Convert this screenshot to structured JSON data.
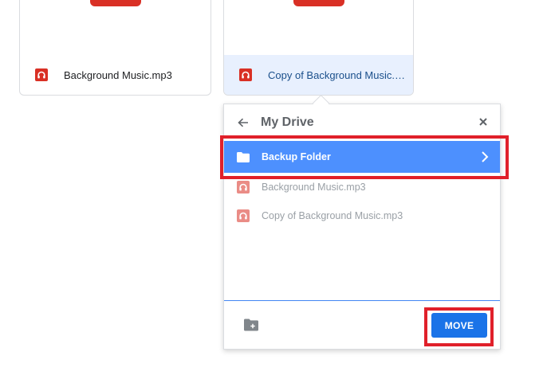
{
  "files": [
    {
      "name": "Background Music.mp3",
      "icon": "audio-file-icon",
      "selected": false
    },
    {
      "name": "Copy of Background Music.mp3",
      "icon": "audio-file-icon",
      "selected": true
    }
  ],
  "move_dialog": {
    "title": "My Drive",
    "back_icon": "arrow-back-icon",
    "close_icon": "close-icon",
    "items": [
      {
        "label": "Backup Folder",
        "type": "folder",
        "icon": "folder-icon",
        "highlighted": true
      },
      {
        "label": "Background Music.mp3",
        "type": "file",
        "icon": "audio-file-icon"
      },
      {
        "label": "Copy of Background Music.mp3",
        "type": "file",
        "icon": "audio-file-icon"
      }
    ],
    "new_folder_icon": "new-folder-icon",
    "move_label": "MOVE"
  },
  "colors": {
    "selection_blue": "#4d90fe",
    "move_button": "#1a73e8",
    "highlight_red": "#e0202a",
    "file_icon_red": "#d93025"
  }
}
